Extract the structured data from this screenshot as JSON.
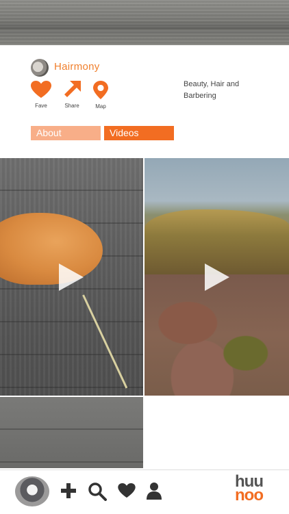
{
  "profile": {
    "name": "Hairmony",
    "category": "Beauty, Hair and Barbering"
  },
  "actions": [
    {
      "label": "Fave",
      "icon": "heart-icon"
    },
    {
      "label": "Share",
      "icon": "share-arrow-icon"
    },
    {
      "label": "Map",
      "icon": "map-pin-icon"
    }
  ],
  "tabs": [
    {
      "label": "About",
      "active": false
    },
    {
      "label": "Videos",
      "active": true
    }
  ],
  "videos": [
    {
      "thumbnail": "cat-on-wood-floor",
      "icon": "play-icon"
    },
    {
      "thumbnail": "heathland-with-deer",
      "icon": "play-icon"
    },
    {
      "thumbnail": "wood-floor"
    }
  ],
  "bottom_nav": [
    {
      "icon": "avatar"
    },
    {
      "icon": "add-icon"
    },
    {
      "icon": "search-icon"
    },
    {
      "icon": "heart-icon"
    },
    {
      "icon": "user-icon"
    }
  ],
  "logo": {
    "line1": "huu",
    "line2": "noo"
  },
  "colors": {
    "accent": "#f26d22",
    "accent_light": "#f8ae88",
    "text": "#444444"
  }
}
